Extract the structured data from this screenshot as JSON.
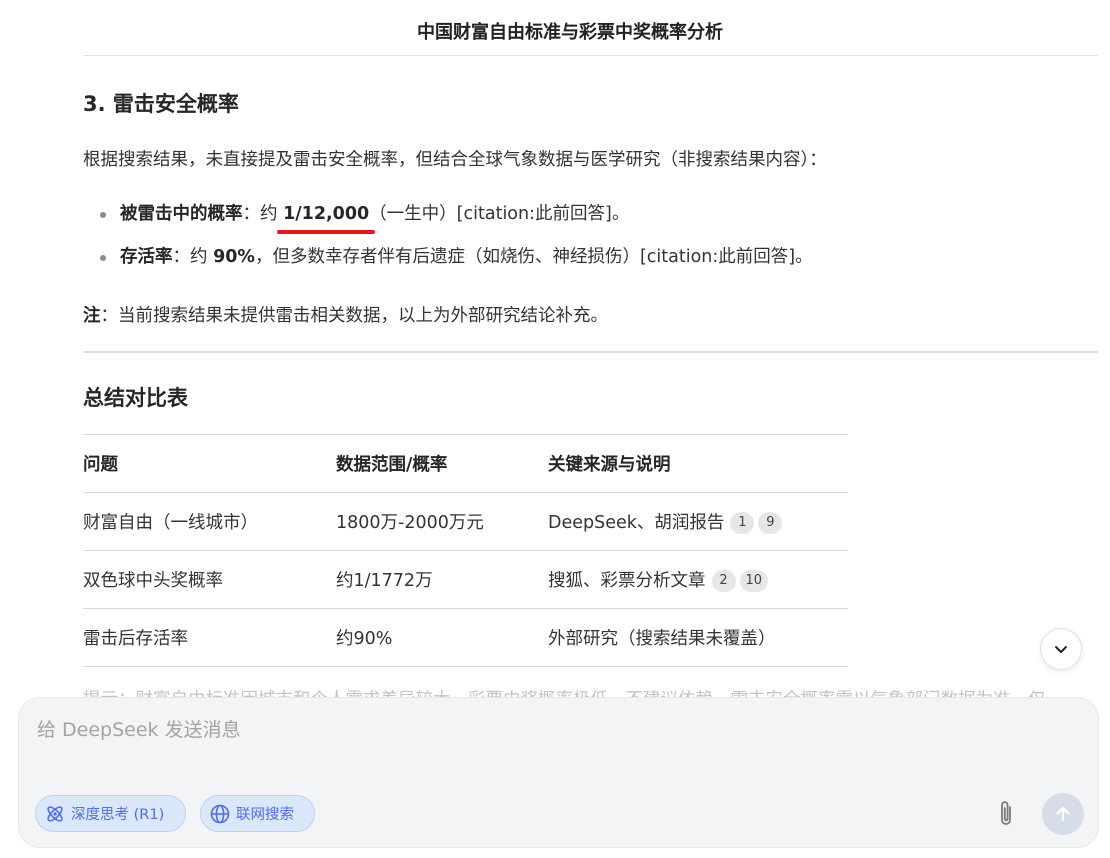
{
  "header": {
    "title": "中国财富自由标准与彩票中奖概率分析"
  },
  "section3": {
    "heading": "3. 雷击安全概率",
    "intro": "根据搜索结果，未直接提及雷击安全概率，但结合全球气象数据与医学研究（非搜索结果内容）：",
    "bullets": [
      {
        "label": "被雷击中的概率",
        "sep": "：约 ",
        "value": "1/12,000",
        "rest": "（一生中）[citation:此前回答]。"
      },
      {
        "label": "存活率",
        "sep": "：约 ",
        "value": "90%",
        "rest": "，但多数幸存者伴有后遗症（如烧伤、神经损伤）[citation:此前回答]。"
      }
    ],
    "note_label": "注",
    "note_text": "：当前搜索结果未提供雷击相关数据，以上为外部研究结论补充。"
  },
  "summary": {
    "heading": "总结对比表",
    "columns": [
      "问题",
      "数据范围/概率",
      "关键来源与说明"
    ],
    "rows": [
      {
        "question": "财富自由（一线城市）",
        "range": "1800万-2000万元",
        "source": "DeepSeek、胡润报告",
        "cites": [
          "1",
          "9"
        ]
      },
      {
        "question": "双色球中头奖概率",
        "range": "约1/1772万",
        "source": "搜狐、彩票分析文章",
        "cites": [
          "2",
          "10"
        ]
      },
      {
        "question": "雷击后存活率",
        "range": "约90%",
        "source": "外部研究（搜索结果未覆盖）",
        "cites": []
      }
    ]
  },
  "faded_line": "提示：财富自由标准因城市和个人需求差异较大，彩票中奖概率极低，不建议依赖。雷击安全概率需以气象部门数据为准，仅",
  "composer": {
    "placeholder": "给 DeepSeek 发送消息",
    "deep_think_label": "深度思考 (R1)",
    "web_search_label": "联网搜索"
  },
  "colors": {
    "accent": "#4d6bfe",
    "highlight_underline": "#e8151b"
  }
}
